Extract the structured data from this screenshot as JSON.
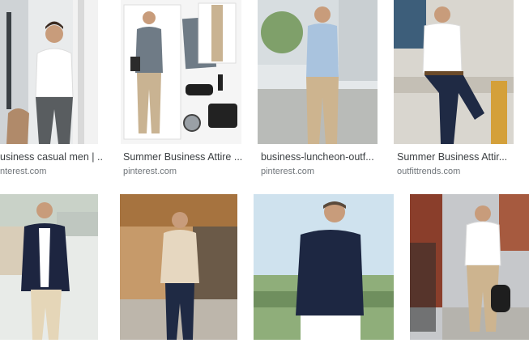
{
  "results": [
    {
      "title": "usiness casual men | ...",
      "source": "nterest.com"
    },
    {
      "title": "Summer Business Attire ...",
      "source": "pinterest.com"
    },
    {
      "title": "business-luncheon-outf...",
      "source": "pinterest.com"
    },
    {
      "title": "Summer Business Attir...",
      "source": "outfittrends.com"
    },
    {
      "title": "",
      "source": ""
    },
    {
      "title": "",
      "source": ""
    },
    {
      "title": "",
      "source": ""
    },
    {
      "title": "",
      "source": ""
    }
  ],
  "colors": {
    "title_text": "#3c4043",
    "source_text": "#70757a"
  }
}
